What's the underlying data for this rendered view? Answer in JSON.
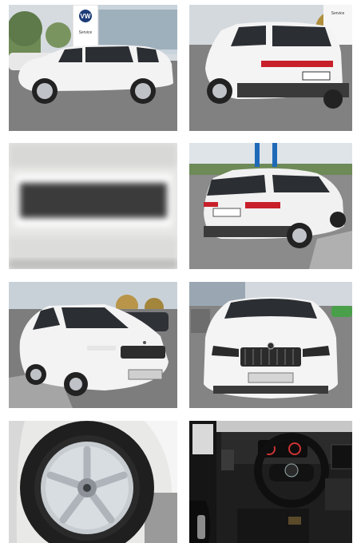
{
  "gallery": {
    "photos": [
      {
        "name": "photo-side-dealership",
        "sign_text": "Service"
      },
      {
        "name": "photo-rear-three-quarter",
        "sign_text": "Service"
      },
      {
        "name": "photo-blurred-plate"
      },
      {
        "name": "photo-rear-parking"
      },
      {
        "name": "photo-front-three-quarter"
      },
      {
        "name": "photo-front"
      },
      {
        "name": "photo-wheel"
      },
      {
        "name": "photo-interior-dashboard"
      }
    ]
  },
  "colors": {
    "car_body": "#f2f2f2",
    "sky": "#cfd6dd",
    "asphalt": "#7c7c7c",
    "glass": "#2b2f33"
  }
}
